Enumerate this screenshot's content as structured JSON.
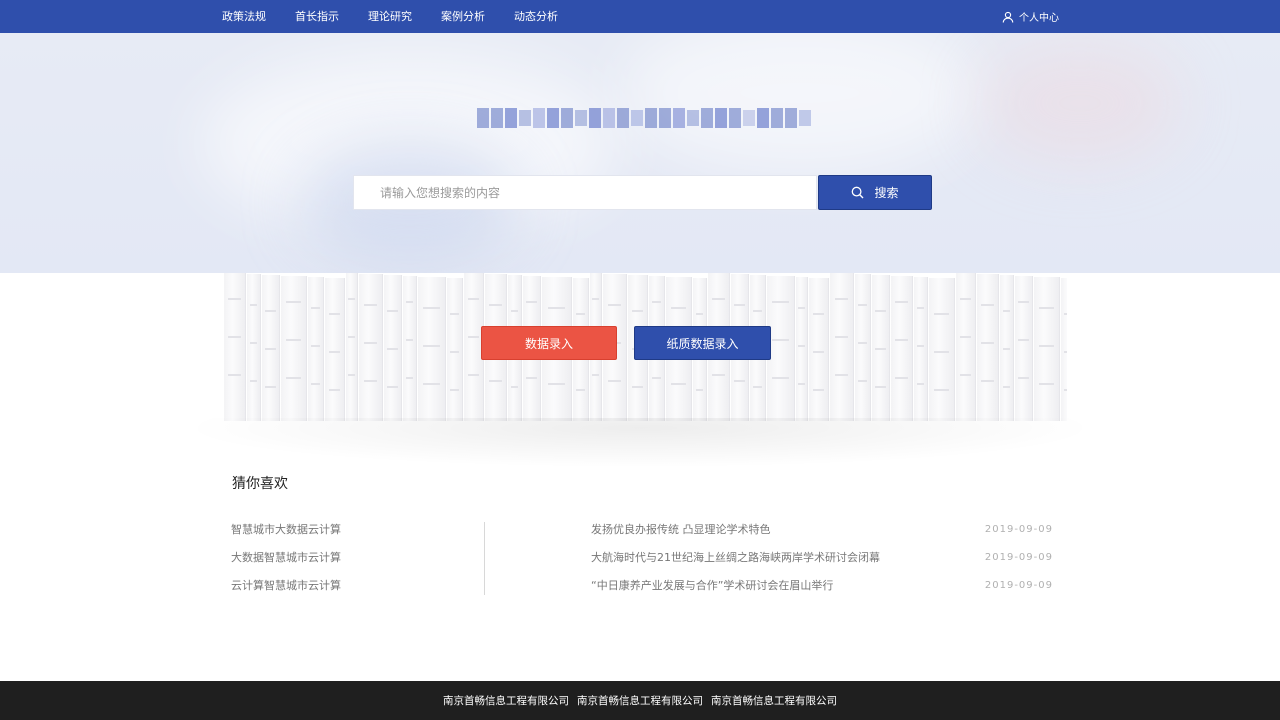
{
  "nav": {
    "items": [
      {
        "label": "政策法规"
      },
      {
        "label": "首长指示"
      },
      {
        "label": "理论研究"
      },
      {
        "label": "案例分析"
      },
      {
        "label": "动态分析"
      }
    ],
    "user_label": "个人中心",
    "user_icon": "user-icon"
  },
  "search": {
    "placeholder": "请输入您想搜索的内容",
    "button_label": "搜索",
    "button_icon": "search-icon"
  },
  "actions": {
    "data_entry_label": "数据录入",
    "paper_entry_label": "纸质数据录入"
  },
  "recommend": {
    "title": "猜你喜欢",
    "left_items": [
      {
        "label": "智慧城市大数据云计算"
      },
      {
        "label": "大数据智慧城市云计算"
      },
      {
        "label": "云计算智慧城市云计算"
      }
    ],
    "right_items": [
      {
        "title": "发扬优良办报传统 凸显理论学术特色",
        "date": "2019-09-09"
      },
      {
        "title": "大航海时代与21世纪海上丝绸之路海峡两岸学术研讨会闭幕",
        "date": "2019-09-09"
      },
      {
        "title": "“中日康养产业发展与合作”学术研讨会在眉山举行",
        "date": "2019-09-09"
      }
    ]
  },
  "footer": {
    "items": [
      "南京首畅信息工程有限公司",
      "南京首畅信息工程有限公司",
      "南京首畅信息工程有限公司"
    ]
  },
  "colors": {
    "primary": "#2f4fac",
    "danger": "#eb5444",
    "footer_bg": "#1f1f1f"
  }
}
